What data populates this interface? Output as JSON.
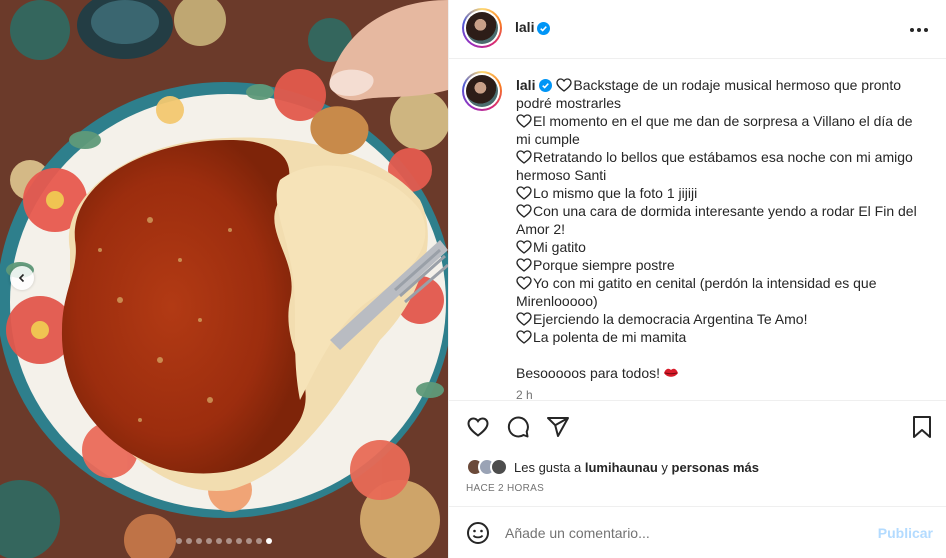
{
  "post": {
    "username": "lali",
    "verified": true,
    "caption_lines": [
      "Backstage de un rodaje musical hermoso que pronto podré mostrarles",
      "El momento en el que me dan de sorpresa a Villano el día de mi cumple",
      "Retratando lo bellos que estábamos esa noche con mi amigo hermoso Santi",
      "Lo mismo que la foto 1 jijiji",
      "Con una cara de dormida interesante yendo a rodar El Fin del Amor 2!",
      "Mi gatito",
      "Porque siempre postre",
      "Yo con mi gatito en cenital (perdón la intensidad es que Mirenlooooo)",
      "Ejerciendo la democracia Argentina Te Amo!",
      "La polenta de mi mamita"
    ],
    "sign_off": "Besooooos para todos!",
    "caption_time": "2 h"
  },
  "likes": {
    "prefix": "Les gusta a",
    "first_liker": "lumihaunau",
    "connector": "y",
    "others": "personas más"
  },
  "time_ago": "HACE 2 HORAS",
  "comment": {
    "placeholder": "Añade un comentario...",
    "publish_label": "Publicar"
  },
  "carousel": {
    "total": 10,
    "active_index": 9
  },
  "colors": {
    "verified_blue": "#0095f6",
    "publish_disabled": "#b3dbff",
    "secondary_text": "#737373",
    "border": "#efefef"
  },
  "icons": [
    "verified-badge-icon",
    "more-options-icon",
    "heart-icon",
    "comment-icon",
    "share-icon",
    "bookmark-icon",
    "emoji-icon",
    "chevron-left-icon",
    "lips-emoji-icon"
  ]
}
